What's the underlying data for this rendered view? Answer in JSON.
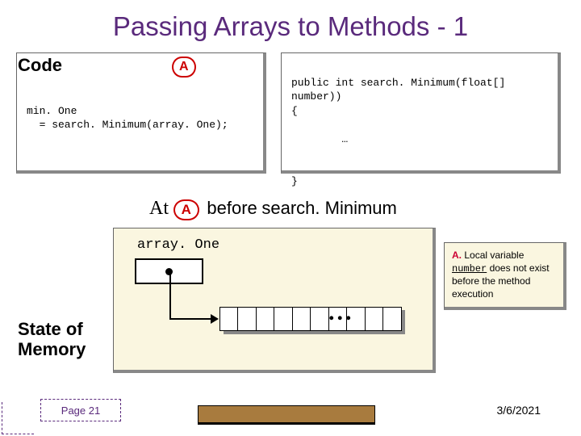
{
  "title": "Passing Arrays to Methods - 1",
  "code": {
    "label": "Code",
    "marker": "A",
    "left_line1": "min. One",
    "left_line2": "  = search. Minimum(array. One);",
    "right_line1": "public int search. Minimum(float[]",
    "right_line2": "number))",
    "right_line3": "{",
    "right_ellipsis": "        …",
    "right_close": "}"
  },
  "at": {
    "at_word": "At",
    "marker": "A",
    "before": "before",
    "method": "search. Minimum"
  },
  "memory": {
    "array_label": "array. One",
    "dots": "..."
  },
  "note": {
    "a": "A.",
    "text1": "Local variable",
    "number": "number",
    "text2": "does  not exist before the method execution"
  },
  "state_label_1": "State of",
  "state_label_2": "Memory",
  "footer": {
    "page": "Page 21",
    "date": "3/6/2021"
  }
}
